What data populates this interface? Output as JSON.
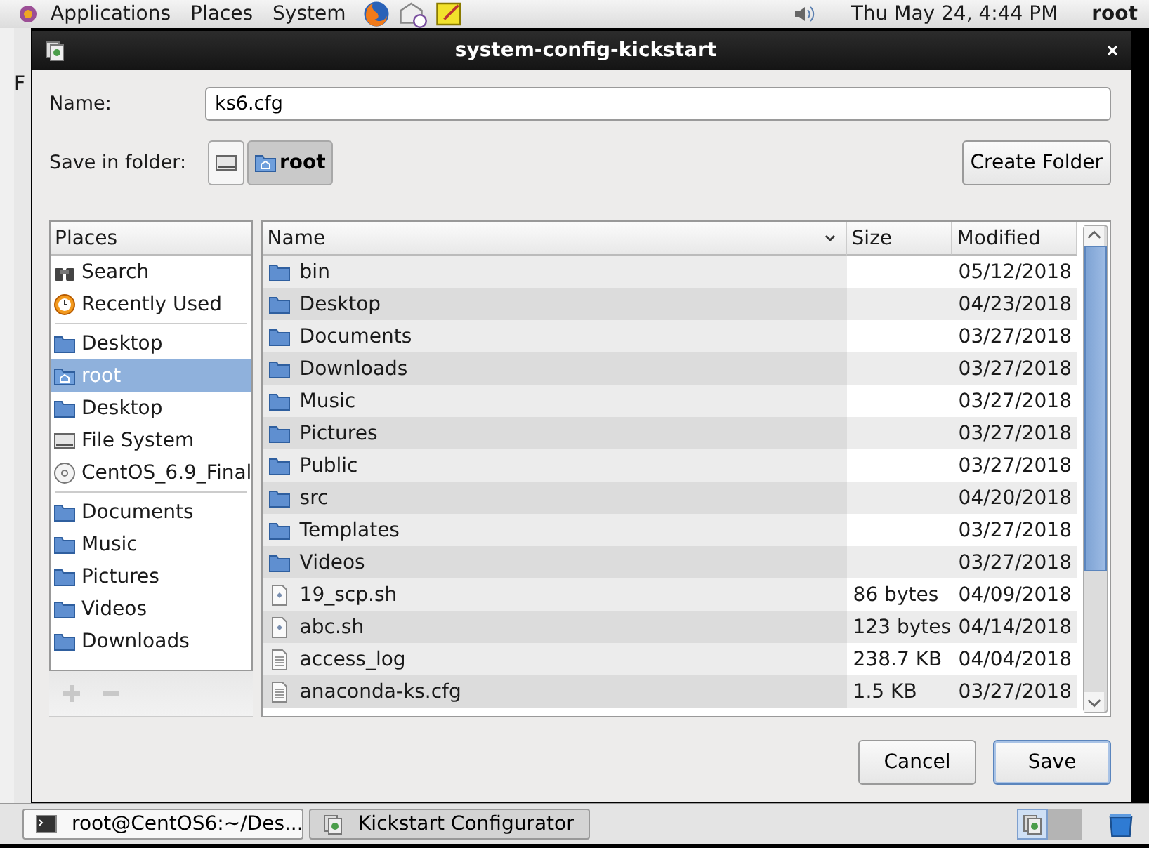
{
  "top_panel": {
    "menus": [
      "Applications",
      "Places",
      "System"
    ],
    "clock": "Thu May 24,  4:44 PM",
    "user": "root"
  },
  "background_window": {
    "menu_text": "F"
  },
  "dialog": {
    "title": "system-config-kickstart",
    "name_label": "Name:",
    "name_value": "ks6.cfg",
    "folder_label": "Save in folder:",
    "path_buttons": [
      {
        "kind": "drive",
        "selected": false
      },
      {
        "kind": "home",
        "label": "root",
        "selected": true
      }
    ],
    "create_folder": "Create Folder",
    "places": {
      "header": "Places",
      "groups": [
        {
          "items": [
            {
              "kind": "search",
              "label": "Search",
              "selected": false
            },
            {
              "kind": "recent",
              "label": "Recently Used",
              "selected": false
            }
          ]
        },
        {
          "items": [
            {
              "kind": "folder",
              "label": "Desktop",
              "selected": false
            },
            {
              "kind": "home",
              "label": "root",
              "selected": true
            },
            {
              "kind": "folder",
              "label": "Desktop",
              "selected": false
            },
            {
              "kind": "drive",
              "label": "File System",
              "selected": false
            },
            {
              "kind": "disc",
              "label": "CentOS_6.9_Final",
              "selected": false
            }
          ]
        },
        {
          "items": [
            {
              "kind": "folder",
              "label": "Documents",
              "selected": false
            },
            {
              "kind": "folder",
              "label": "Music",
              "selected": false
            },
            {
              "kind": "folder",
              "label": "Pictures",
              "selected": false
            },
            {
              "kind": "folder",
              "label": "Videos",
              "selected": false
            },
            {
              "kind": "folder",
              "label": "Downloads",
              "selected": false
            }
          ]
        }
      ]
    },
    "table": {
      "columns": [
        "Name",
        "Size",
        "Modified"
      ],
      "rows": [
        {
          "kind": "folder",
          "name": "bin",
          "modified": "05/12/2018"
        },
        {
          "kind": "folder",
          "name": "Desktop",
          "modified": "04/23/2018"
        },
        {
          "kind": "folder",
          "name": "Documents",
          "modified": "03/27/2018"
        },
        {
          "kind": "folder",
          "name": "Downloads",
          "modified": "03/27/2018"
        },
        {
          "kind": "folder",
          "name": "Music",
          "modified": "03/27/2018"
        },
        {
          "kind": "folder",
          "name": "Pictures",
          "modified": "03/27/2018"
        },
        {
          "kind": "folder",
          "name": "Public",
          "modified": "03/27/2018"
        },
        {
          "kind": "folder",
          "name": "src",
          "modified": "04/20/2018"
        },
        {
          "kind": "folder",
          "name": "Templates",
          "modified": "03/27/2018"
        },
        {
          "kind": "folder",
          "name": "Videos",
          "modified": "03/27/2018"
        },
        {
          "kind": "script",
          "name": "19_scp.sh",
          "size": "86 bytes",
          "modified": "04/09/2018"
        },
        {
          "kind": "script",
          "name": "abc.sh",
          "size": "123 bytes",
          "modified": "04/14/2018"
        },
        {
          "kind": "text",
          "name": "access_log",
          "size": "238.7 KB",
          "modified": "04/04/2018"
        },
        {
          "kind": "text",
          "name": "anaconda-ks.cfg",
          "size": "1.5 KB",
          "modified": "03/27/2018"
        }
      ]
    },
    "buttons": [
      {
        "label": "Cancel",
        "default": false
      },
      {
        "label": "Save",
        "default": true
      }
    ]
  },
  "taskbar": {
    "items": [
      {
        "kind": "terminal",
        "label": "root@CentOS6:~/Des...",
        "selected": false
      },
      {
        "kind": "kickstart",
        "label": "Kickstart Configurator",
        "selected": true
      }
    ]
  }
}
